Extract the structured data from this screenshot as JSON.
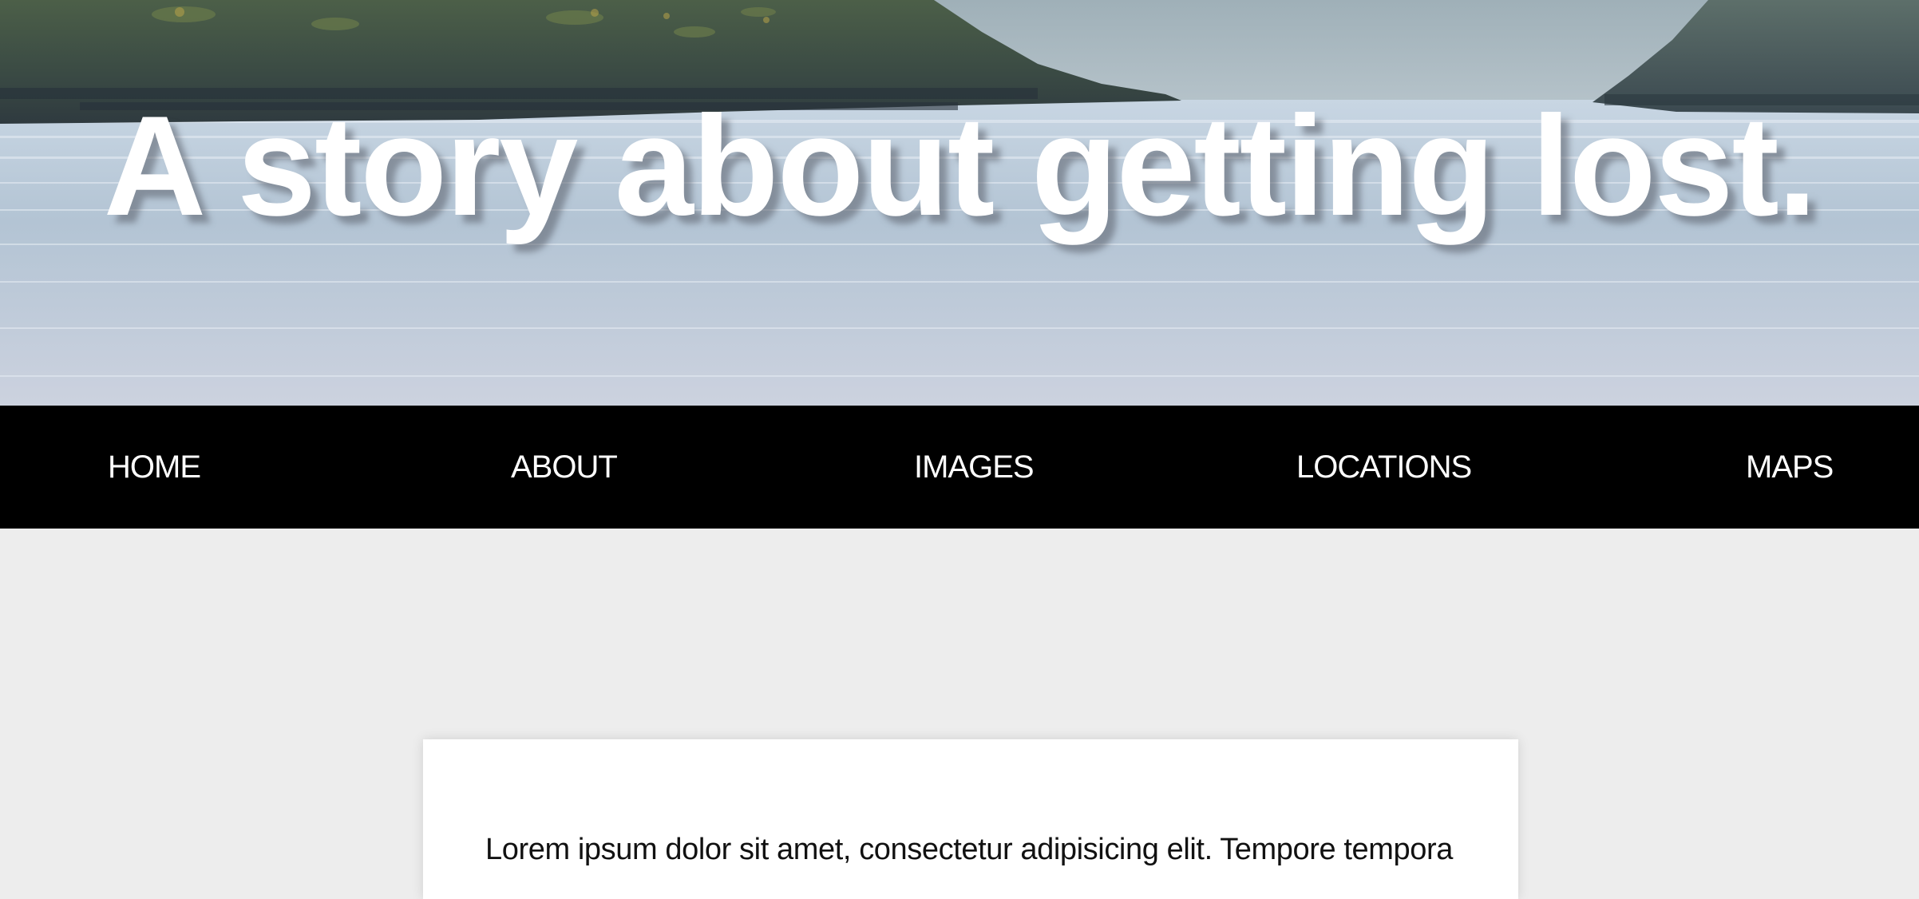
{
  "hero": {
    "title": "A story about getting lost."
  },
  "nav": {
    "items": [
      {
        "label": "HOME"
      },
      {
        "label": "ABOUT"
      },
      {
        "label": "IMAGES"
      },
      {
        "label": "LOCATIONS"
      },
      {
        "label": "MAPS"
      }
    ]
  },
  "content": {
    "paragraph": "Lorem ipsum dolor sit amet, consectetur adipisicing elit. Tempore tempora"
  },
  "colors": {
    "nav_background": "#000000",
    "page_background": "#ededed",
    "card_background": "#ffffff"
  }
}
